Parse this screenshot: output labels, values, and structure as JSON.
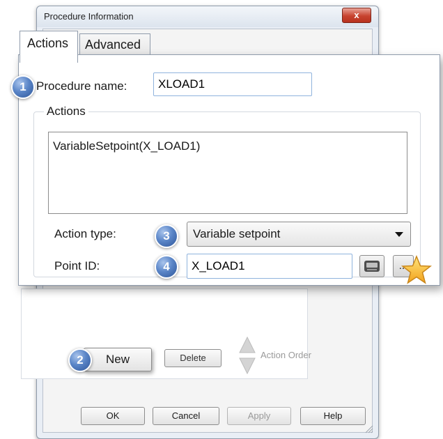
{
  "background_dialog": {
    "title": "Procedure Information",
    "close_label": "x",
    "new_button": "New",
    "delete_button": "Delete",
    "action_order_label": "Action Order",
    "ok_button": "OK",
    "cancel_button": "Cancel",
    "apply_button": "Apply",
    "help_button": "Help"
  },
  "tabs": [
    {
      "label": "Actions",
      "selected": true
    },
    {
      "label": "Advanced",
      "selected": false
    }
  ],
  "form": {
    "procedure_name_label": "Procedure name:",
    "procedure_name_value": "XLOAD1",
    "actions_group_label": "Actions",
    "actions_list_value": "VariableSetpoint(X_LOAD1)",
    "action_type_label": "Action type:",
    "action_type_value": "Variable setpoint",
    "point_id_label": "Point ID:",
    "point_id_value": "X_LOAD1",
    "more_button_label": "..."
  },
  "badges": {
    "procedure_name": "1",
    "new_button": "2",
    "action_type": "3",
    "point_id": "4"
  },
  "icons": {
    "point_picker": "point-browser-icon",
    "highlight": "star-icon",
    "dropdown": "chevron-down-icon",
    "close": "close-icon",
    "move_up": "arrow-up-icon",
    "move_down": "arrow-down-icon"
  },
  "colors": {
    "badge": "#4a76bd",
    "star": "#f5b82e",
    "input_border": "#8fb3dd",
    "close_button": "#c7432f"
  }
}
